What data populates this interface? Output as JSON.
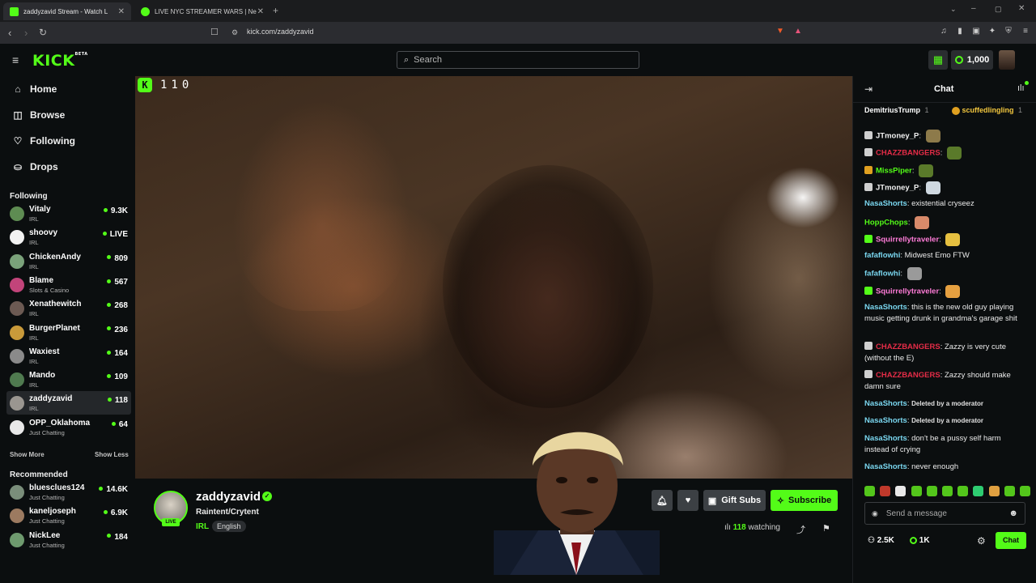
{
  "browser": {
    "tabs": [
      {
        "label": "zaddyzavid Stream - Watch L",
        "active": true
      },
      {
        "label": "LIVE NYC STREAMER WARS | Ne",
        "active": false
      }
    ],
    "url": "kick.com/zaddyzavid"
  },
  "topbar": {
    "logo": "KICK",
    "logo_beta": "BETA",
    "search_placeholder": "Search",
    "kicks_balance": "1,000"
  },
  "sidebar": {
    "nav": [
      {
        "label": "Home",
        "icon": "home-icon"
      },
      {
        "label": "Browse",
        "icon": "browse-icon"
      },
      {
        "label": "Following",
        "icon": "heart-icon"
      },
      {
        "label": "Drops",
        "icon": "drops-icon"
      }
    ],
    "following_title": "Following",
    "following": [
      {
        "name": "Vitaly",
        "category": "IRL",
        "viewers": "9.3K",
        "color": "#5e8c52"
      },
      {
        "name": "shoovy",
        "category": "IRL",
        "viewers": "LIVE",
        "color": "#f2f2f2"
      },
      {
        "name": "ChickenAndy",
        "category": "IRL",
        "viewers": "809",
        "color": "#7aa27a"
      },
      {
        "name": "Blame",
        "category": "Slots & Casino",
        "viewers": "567",
        "color": "#c2447a"
      },
      {
        "name": "Xenathewitch",
        "category": "IRL",
        "viewers": "268",
        "color": "#6c5a53"
      },
      {
        "name": "BurgerPlanet",
        "category": "IRL",
        "viewers": "236",
        "color": "#c99a3a"
      },
      {
        "name": "Waxiest",
        "category": "IRL",
        "viewers": "164",
        "color": "#8a8a8a"
      },
      {
        "name": "Mando",
        "category": "IRL",
        "viewers": "109",
        "color": "#4f7a4f"
      },
      {
        "name": "zaddyzavid",
        "category": "IRL",
        "viewers": "118",
        "color": "#9a9690",
        "selected": true
      },
      {
        "name": "OPP_Oklahoma",
        "category": "Just Chatting",
        "viewers": "64",
        "color": "#e8e8e8"
      }
    ],
    "show_more": "Show More",
    "show_less": "Show Less",
    "recommended_title": "Recommended",
    "recommended": [
      {
        "name": "bluesclues124",
        "category": "Just Chatting",
        "viewers": "14.6K",
        "color": "#7a8e7a"
      },
      {
        "name": "kaneljoseph",
        "category": "Just Chatting",
        "viewers": "6.9K",
        "color": "#9c7a60"
      },
      {
        "name": "NickLee",
        "category": "Just Chatting",
        "viewers": "184",
        "color": "#6e9a6e"
      }
    ]
  },
  "player": {
    "viewer_overlay": "110"
  },
  "stream": {
    "streamer": "zaddyzavid",
    "live_badge": "LIVE",
    "title": "Raintent/Crytent",
    "category": "IRL",
    "language": "English",
    "gift_subs": "Gift Subs",
    "subscribe": "Subscribe",
    "watching_count": "118",
    "watching_label": "watching"
  },
  "chat": {
    "title": "Chat",
    "pinned": [
      {
        "user": "DemitriusTrump",
        "count": "1"
      },
      {
        "user": "scuffedlingling",
        "count": "1"
      }
    ],
    "messages": [
      {
        "user": "JTmoney_P",
        "sep": ":",
        "text": "",
        "color": "#f0f0f0",
        "emote": "#8d7a4a",
        "badge": "#cfcfcf"
      },
      {
        "user": "CHAZZBANGERS",
        "sep": ":",
        "text": "",
        "color": "#e52c47",
        "emote": "#5a7a2a",
        "badge": "#cfcfcf"
      },
      {
        "user": "MissPiper",
        "sep": ":",
        "text": "",
        "color": "#53fc18",
        "emote": "#5a7a2a",
        "badge": "#e0a020"
      },
      {
        "user": "JTmoney_P",
        "sep": ":",
        "text": "",
        "color": "#f0f0f0",
        "emote": "#cfd8e0",
        "badge": "#cfcfcf"
      },
      {
        "user": "NasaShorts",
        "sep": ":",
        "text": "existential cryseez",
        "color": "#7ad7f0"
      },
      {
        "user": "HoppChops",
        "sep": ":",
        "text": "",
        "color": "#53fc18",
        "emote": "#d88a6a"
      },
      {
        "user": "Squirrellytraveler",
        "sep": ":",
        "text": "",
        "color": "#ff7cd8",
        "emote": "#e6c040",
        "badge": "#53fc18"
      },
      {
        "user": "fafaflowhi",
        "sep": ":",
        "text": "Midwest Emo FTW",
        "color": "#7ad7f0"
      },
      {
        "user": "fafaflowhi",
        "sep": ":",
        "text": "",
        "color": "#7ad7f0",
        "emote": "#9a9a9a"
      },
      {
        "user": "Squirrellytraveler",
        "sep": ":",
        "text": "",
        "color": "#ff7cd8",
        "emote": "#e6a040",
        "badge": "#53fc18"
      },
      {
        "user": "NasaShorts",
        "sep": ":",
        "text": "this is the new old guy playing music getting drunk in grandma's garage shit",
        "color": "#7ad7f0"
      },
      {
        "user": "CHAZZBANGERS",
        "sep": ":",
        "text": "Zazzy is very cute (without the E)",
        "color": "#e52c47",
        "badge": "#cfcfcf"
      },
      {
        "user": "CHAZZBANGERS",
        "sep": ":",
        "text": "Zazzy should make damn sure",
        "color": "#e52c47",
        "badge": "#cfcfcf"
      },
      {
        "user": "NasaShorts",
        "sep": ":",
        "text": "Deleted by a moderator",
        "color": "#7ad7f0",
        "deleted": true
      },
      {
        "user": "NasaShorts",
        "sep": ":",
        "text": "Deleted by a moderator",
        "color": "#7ad7f0",
        "deleted": true
      },
      {
        "user": "NasaShorts",
        "sep": ":",
        "text": "don't be a pussy self harm instead of crying",
        "color": "#7ad7f0"
      },
      {
        "user": "NasaShorts",
        "sep": ":",
        "text": "never enough",
        "color": "#7ad7f0"
      }
    ],
    "input_placeholder": "Send a message",
    "stat_followers": "2.5K",
    "stat_kicks": "1K",
    "chat_button": "Chat"
  },
  "colors": {
    "accent": "#53fc18",
    "background": "#0b0e0f"
  }
}
